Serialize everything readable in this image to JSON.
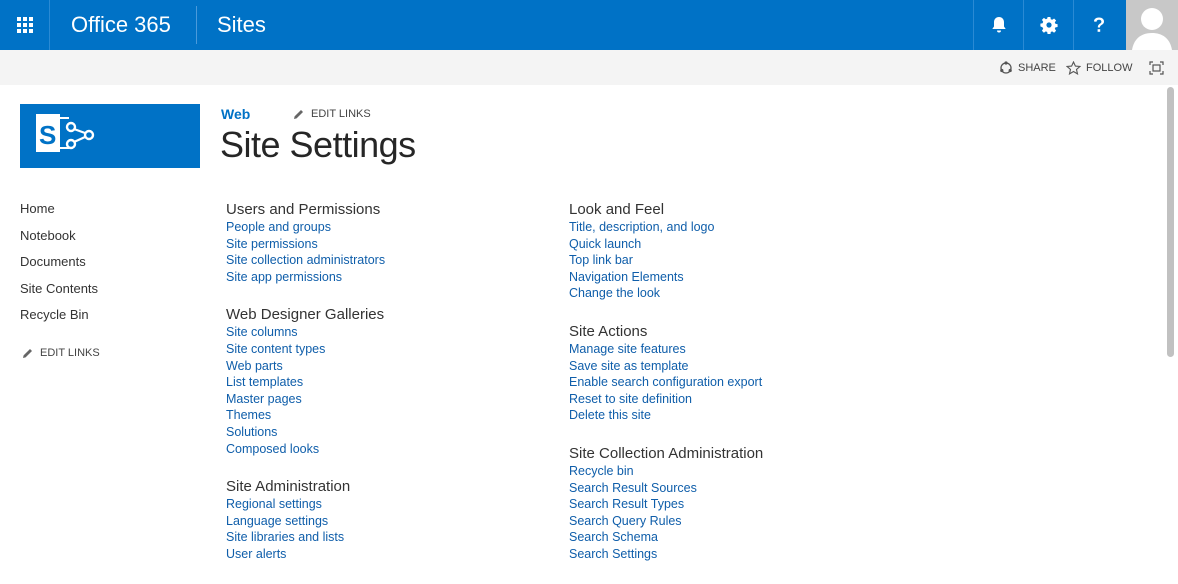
{
  "suitebar": {
    "brand": "Office 365",
    "app": "Sites"
  },
  "ribbon": {
    "share": "SHARE",
    "follow": "FOLLOW"
  },
  "header": {
    "breadcrumb": "Web",
    "edit_links": "EDIT LINKS",
    "title": "Site Settings"
  },
  "quicklaunch": {
    "items": [
      "Home",
      "Notebook",
      "Documents",
      "Site Contents",
      "Recycle Bin"
    ],
    "edit_links": "EDIT LINKS"
  },
  "sections": {
    "users_permissions": {
      "title": "Users and Permissions",
      "links": [
        "People and groups",
        "Site permissions",
        "Site collection administrators",
        "Site app permissions"
      ]
    },
    "web_designer": {
      "title": "Web Designer Galleries",
      "links": [
        "Site columns",
        "Site content types",
        "Web parts",
        "List templates",
        "Master pages",
        "Themes",
        "Solutions",
        "Composed looks"
      ]
    },
    "site_admin": {
      "title": "Site Administration",
      "links": [
        "Regional settings",
        "Language settings",
        "Site libraries and lists",
        "User alerts"
      ]
    },
    "look_feel": {
      "title": "Look and Feel",
      "links": [
        "Title, description, and logo",
        "Quick launch",
        "Top link bar",
        "Navigation Elements",
        "Change the look"
      ]
    },
    "site_actions": {
      "title": "Site Actions",
      "links": [
        "Manage site features",
        "Save site as template",
        "Enable search configuration export",
        "Reset to site definition",
        "Delete this site"
      ]
    },
    "site_collection_admin": {
      "title": "Site Collection Administration",
      "links": [
        "Recycle bin",
        "Search Result Sources",
        "Search Result Types",
        "Search Query Rules",
        "Search Schema",
        "Search Settings"
      ]
    }
  },
  "colors": {
    "suitebar": "#0072c6",
    "link": "#0f5eaa"
  }
}
